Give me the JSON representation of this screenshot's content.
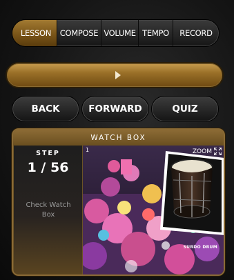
{
  "tabs": [
    {
      "label": "LESSON",
      "active": true
    },
    {
      "label": "COMPOSE",
      "active": false
    },
    {
      "label": "VOLUME",
      "active": false
    },
    {
      "label": "TEMPO",
      "active": false
    },
    {
      "label": "RECORD",
      "active": false
    }
  ],
  "progress": {
    "value": 0.0,
    "icon": "play-icon"
  },
  "nav": {
    "back": "BACK",
    "forward": "FORWARD",
    "quiz": "QUIZ"
  },
  "watch_box": {
    "title": "WATCH BOX",
    "step_label": "STEP",
    "step_value": "1 / 56",
    "check_link": "Check Watch Box",
    "zoom_label": "ZOOM",
    "zoom_icon": "expand-icon",
    "image_frame_number": "1",
    "image_caption": "SURDO DRUM"
  },
  "colors": {
    "accent_gold": "#9a7028",
    "dark": "#141414"
  }
}
